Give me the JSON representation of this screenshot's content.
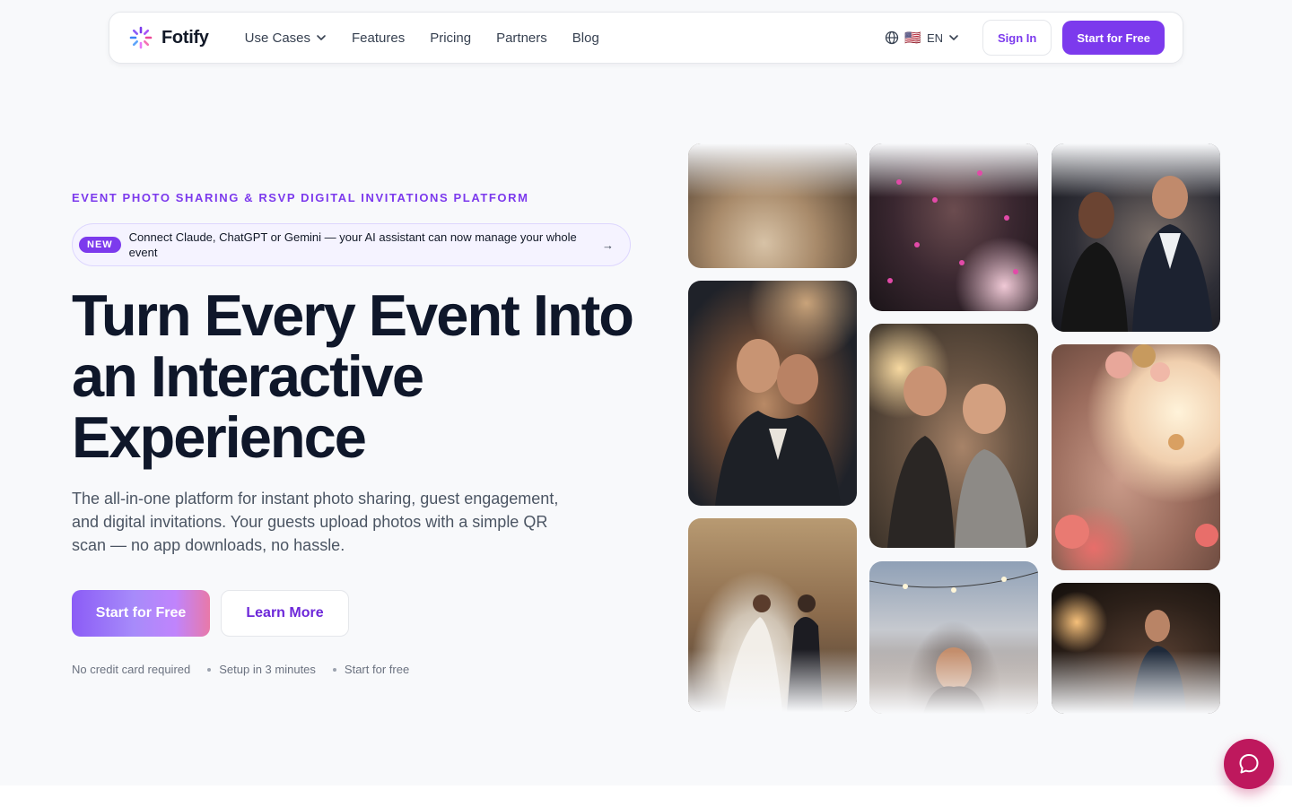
{
  "brand": {
    "name": "Fotify",
    "accent": "#7c3aed"
  },
  "nav": {
    "links": [
      {
        "label": "Use Cases",
        "dropdown": true
      },
      {
        "label": "Features"
      },
      {
        "label": "Pricing"
      },
      {
        "label": "Partners"
      },
      {
        "label": "Blog"
      }
    ],
    "language": {
      "icon": "globe-icon",
      "flag": "🇺🇸",
      "code": "EN"
    },
    "sign_in": "Sign In",
    "start": "Start for Free"
  },
  "hero": {
    "eyebrow": "EVENT PHOTO SHARING & RSVP DIGITAL INVITATIONS PLATFORM",
    "announcement": {
      "badge": "NEW",
      "text": "Connect Claude, ChatGPT or Gemini — your AI assistant can now manage your whole event",
      "arrow": "→"
    },
    "headline": "Turn Every Event Into an Interactive Experience",
    "subtext": "The all-in-one platform for instant photo sharing, guest engagement, and digital invitations. Your guests upload photos with a simple QR scan — no app downloads, no hassle.",
    "cta_primary": "Start for Free",
    "cta_secondary": "Learn More",
    "perks": [
      "No credit card required",
      "Setup in 3 minutes",
      "Start for free"
    ]
  },
  "gallery": [
    "wedding-dress-photo",
    "groom-hug-photo",
    "first-dance-photo",
    "party-confetti-photo",
    "friends-wine-photo",
    "rooftop-dance-photo",
    "cocktail-guests-photo",
    "balloon-room-photo",
    "speaker-mic-photo"
  ],
  "chat": {
    "icon": "chat-bubble-icon"
  }
}
